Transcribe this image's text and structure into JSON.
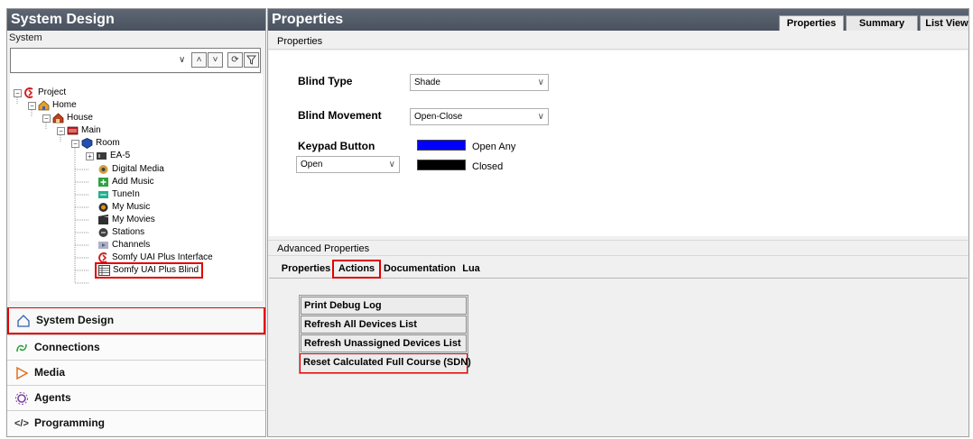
{
  "left_pane": {
    "title": "System Design",
    "system_label": "System",
    "tree": [
      {
        "label": "Project",
        "icon": "project-icon"
      },
      {
        "label": "Home",
        "icon": "home-icon"
      },
      {
        "label": "House",
        "icon": "house-icon"
      },
      {
        "label": "Main",
        "icon": "floor-icon"
      },
      {
        "label": "Room",
        "icon": "room-icon"
      },
      {
        "label": "EA-5",
        "icon": "controller-icon"
      },
      {
        "label": "Digital Media",
        "icon": "digital-media-icon"
      },
      {
        "label": "Add Music",
        "icon": "add-music-icon"
      },
      {
        "label": "TuneIn",
        "icon": "tunein-icon"
      },
      {
        "label": "My Music",
        "icon": "my-music-icon"
      },
      {
        "label": "My Movies",
        "icon": "my-movies-icon"
      },
      {
        "label": "Stations",
        "icon": "stations-icon"
      },
      {
        "label": "Channels",
        "icon": "channels-icon"
      },
      {
        "label": "Somfy UAI Plus Interface",
        "icon": "driver-icon"
      },
      {
        "label": "Somfy UAI Plus Blind",
        "icon": "blind-icon"
      }
    ],
    "splitter_dots": "........",
    "nav": [
      {
        "label": "System Design",
        "icon": "system-design-icon"
      },
      {
        "label": "Connections",
        "icon": "connections-icon"
      },
      {
        "label": "Media",
        "icon": "media-icon"
      },
      {
        "label": "Agents",
        "icon": "agents-icon"
      },
      {
        "label": "Programming",
        "icon": "programming-icon"
      }
    ]
  },
  "right_pane": {
    "title": "Properties",
    "tabs": [
      "Properties",
      "Summary",
      "List View"
    ],
    "active_tab": "Properties",
    "section_label": "Properties",
    "fields": {
      "blind_type_label": "Blind Type",
      "blind_type_value": "Shade",
      "blind_movement_label": "Blind Movement",
      "blind_movement_value": "Open-Close",
      "keypad_button_label": "Keypad Button",
      "keypad_button_value": "Open",
      "legend": [
        {
          "label": "Open Any",
          "color": "#0000ff"
        },
        {
          "label": "Closed",
          "color": "#000000"
        }
      ]
    },
    "advanced_label": "Advanced Properties",
    "advanced_tabs": [
      "Properties",
      "Actions",
      "Documentation",
      "Lua"
    ],
    "active_advanced_tab": "Actions",
    "actions": [
      "Print Debug Log",
      "Refresh All Devices List",
      "Refresh Unassigned Devices List",
      "Reset Calculated Full Course (SDN)"
    ]
  },
  "highlight_color": "#e00000"
}
